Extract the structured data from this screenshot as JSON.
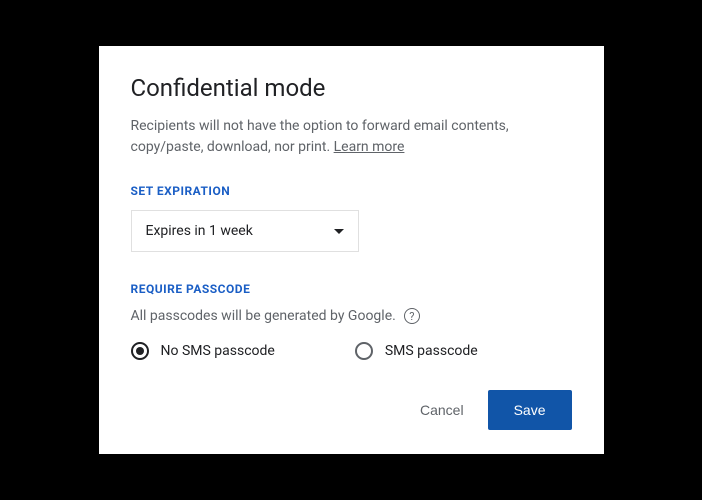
{
  "dialog": {
    "title": "Confidential mode",
    "description": "Recipients will not have the option to forward email contents, copy/paste, download, nor print. ",
    "learn_more": "Learn more"
  },
  "expiration": {
    "label": "SET EXPIRATION",
    "selected": "Expires in 1 week"
  },
  "passcode": {
    "label": "REQUIRE PASSCODE",
    "note": "All passcodes will be generated by Google.",
    "options": {
      "no_sms": "No SMS passcode",
      "sms": "SMS passcode"
    },
    "selected": "no_sms"
  },
  "actions": {
    "cancel": "Cancel",
    "save": "Save"
  }
}
